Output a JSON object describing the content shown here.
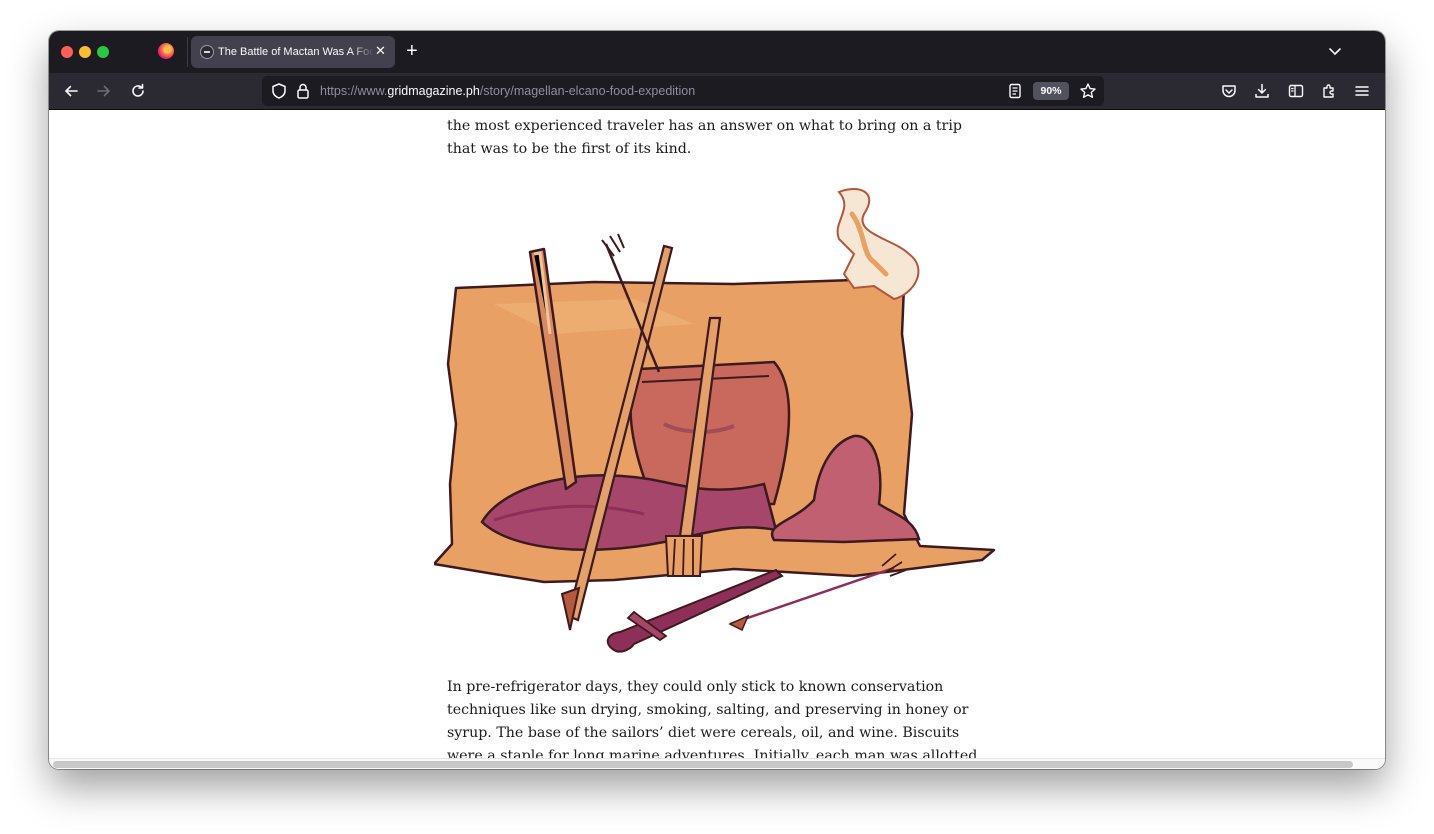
{
  "browser": {
    "tab": {
      "title": "The Battle of Mactan Was A Food Expedition",
      "favicon": "grid-magazine-favicon"
    },
    "new_tab_label": "+",
    "close_tab_label": "✕",
    "url": {
      "prefix": "https://www.",
      "domain": "gridmagazine.ph",
      "path": "/story/magellan-elcano-food-expedition"
    },
    "zoom": "90%",
    "icons": {
      "back": "back-arrow-icon",
      "forward": "forward-arrow-icon",
      "reload": "reload-icon",
      "tracking_protection": "shield-icon",
      "secure": "lock-icon",
      "reader_view": "reader-view-icon",
      "bookmark": "star-icon",
      "pocket": "pocket-icon",
      "downloads": "download-icon",
      "sidebar": "sidebar-icon",
      "extensions": "puzzle-icon",
      "menu": "hamburger-menu-icon",
      "list_all_tabs": "chevron-down-icon"
    }
  },
  "article": {
    "para_top": "the most experienced traveler has an answer on what to bring on a trip that was to be the first of its kind.",
    "para_bottom": "In pre-refrigerator days, they could only stick to known conservation techniques like sun drying, smoking, salting, and preserving in honey or syrup. The base of the sailors’ diet were cereals, oil, and wine. Biscuits were a staple for long marine adventures. Initially, each man was allotted nine",
    "illustration": "illustration of a battered map with a fish, a cooking pot, a knife, a spear, a fork, a sword, an arrow and a smoking torn corner"
  },
  "colors": {
    "chrome_dark": "#1c1b22",
    "toolbar": "#2b2a33",
    "tab_active": "#42414d",
    "map_orange": "#e8a065",
    "ink_brown": "#3d1a1e",
    "plum": "#8e2f5a"
  }
}
